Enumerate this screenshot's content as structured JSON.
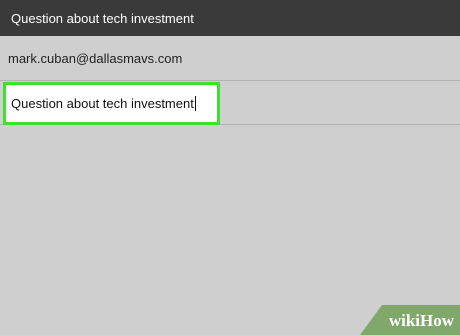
{
  "header": {
    "title": "Question about tech investment"
  },
  "compose": {
    "to_value": "mark.cuban@dallasmavs.com",
    "subject_value": "Question about tech investment",
    "subject_highlight_color": "#3ee02d"
  },
  "watermark": {
    "part1": "wiki",
    "part2": "How",
    "background_color": "#7fa86a"
  }
}
